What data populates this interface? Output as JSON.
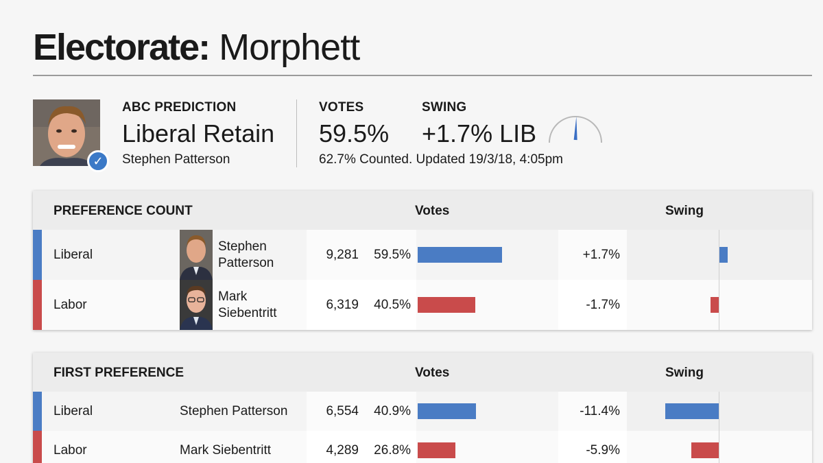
{
  "header": {
    "title_bold": "Electorate:",
    "title_light": "Morphett"
  },
  "summary": {
    "prediction_label": "ABC PREDICTION",
    "prediction": "Liberal Retain",
    "candidate": "Stephen Patterson",
    "votes_label": "VOTES",
    "votes": "59.5%",
    "swing_label": "SWING",
    "swing": "+1.7% LIB",
    "counted": "62.7% Counted. Updated 19/3/18, 4:05pm",
    "check_icon": "checkmark-icon"
  },
  "preference_count": {
    "title": "PREFERENCE COUNT",
    "votes_header": "Votes",
    "swing_header": "Swing",
    "rows": [
      {
        "party": "Liberal",
        "name_line1": "Stephen",
        "name_line2": "Patterson",
        "votes": "9,281",
        "pct": "59.5%",
        "pct_value": 59.5,
        "swing": "+1.7%",
        "swing_value": 1.7,
        "color": "#4a7cc4"
      },
      {
        "party": "Labor",
        "name_line1": "Mark",
        "name_line2": "Siebentritt",
        "votes": "6,319",
        "pct": "40.5%",
        "pct_value": 40.5,
        "swing": "-1.7%",
        "swing_value": -1.7,
        "color": "#c94b4b"
      }
    ]
  },
  "first_preference": {
    "title": "FIRST PREFERENCE",
    "votes_header": "Votes",
    "swing_header": "Swing",
    "rows": [
      {
        "party": "Liberal",
        "name": "Stephen Patterson",
        "votes": "6,554",
        "pct": "40.9%",
        "pct_value": 40.9,
        "swing": "-11.4%",
        "swing_value": -11.4,
        "color": "#4a7cc4"
      },
      {
        "party": "Labor",
        "name": "Mark Siebentritt",
        "votes": "4,289",
        "pct": "26.8%",
        "pct_value": 26.8,
        "swing": "-5.9%",
        "swing_value": -5.9,
        "color": "#c94b4b"
      }
    ]
  }
}
